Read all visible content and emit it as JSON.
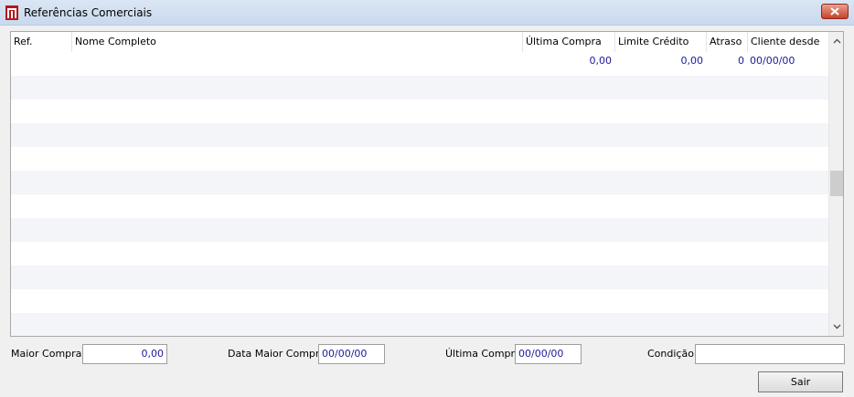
{
  "window": {
    "title": "Referências Comerciais",
    "app_icon": "app-logo-icon",
    "close_icon": "close-icon",
    "accent": "#c7432a"
  },
  "grid": {
    "columns": [
      "Ref.",
      "Nome Completo",
      "Última Compra",
      "Limite Crédito",
      "Atraso",
      "Cliente desde"
    ],
    "rows": [
      {
        "ref": "",
        "nome": "",
        "ultima_compra": "0,00",
        "limite_credito": "0,00",
        "atraso": "0",
        "cliente_desde": "00/00/00"
      }
    ],
    "value_color": "#1a1a9c",
    "alt_row_color": "#f4f5f9",
    "scroll_up_icon": "chevron-up-icon",
    "scroll_down_icon": "chevron-down-icon"
  },
  "footer": {
    "maior_compra_label": "Maior Compra",
    "maior_compra_value": "0,00",
    "data_maior_compra_label": "Data Maior Compra",
    "data_maior_compra_value": "00/00/00",
    "ultima_compra_label": "Última Compra",
    "ultima_compra_value": "00/00/00",
    "condicao_label": "Condição",
    "condicao_value": "",
    "sair_label": "Sair"
  }
}
